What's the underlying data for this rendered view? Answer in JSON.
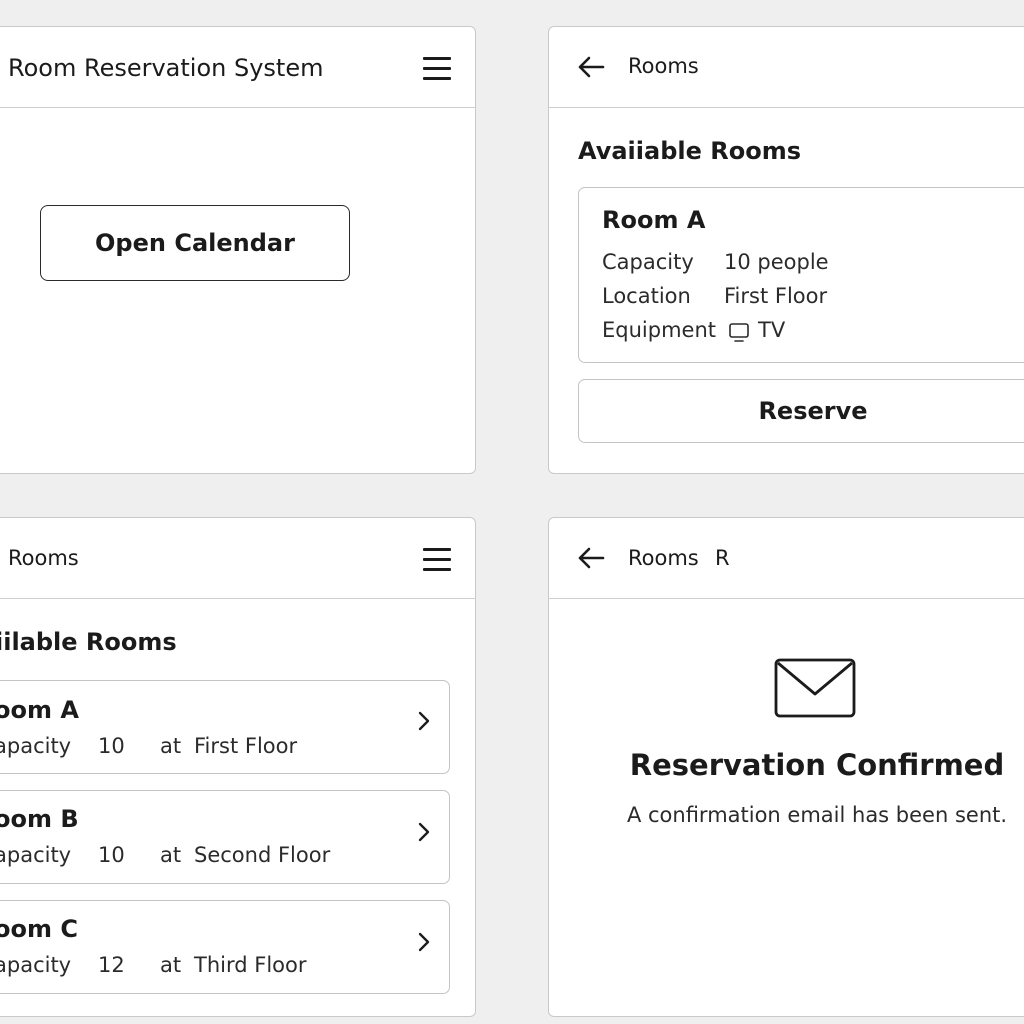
{
  "home": {
    "title": "Room Reservation System",
    "menu_icon": "hamburger-menu-icon",
    "open_calendar_label": "Open Calendar"
  },
  "detail": {
    "back_icon": "arrow-left-icon",
    "header_label": "Rooms",
    "section_title": "Avaiiable Rooms",
    "room": {
      "name": "Room A",
      "capacity_label": "Capacity",
      "capacity_value": "10 people",
      "location_label": "Location",
      "location_value": "First Floor",
      "equipment_label": "Equipment",
      "equipment_icon": "tv-icon",
      "equipment_value": "TV"
    },
    "reserve_label": "Reserve"
  },
  "list": {
    "header_label": "Rooms",
    "menu_icon": "hamburger-menu-icon",
    "section_title": "iilable Rooms",
    "rooms": [
      {
        "name": "oom A",
        "capacity_label": "apacity",
        "capacity": "10",
        "at": "at",
        "location": "First Floor"
      },
      {
        "name": "oom B",
        "capacity_label": "apacity",
        "capacity": "10",
        "at": "at",
        "location": "Second Floor"
      },
      {
        "name": "oom C",
        "capacity_label": "apacity",
        "capacity": "12",
        "at": "at",
        "location": "Third Floor"
      }
    ],
    "chevron_icon": "chevron-right-icon"
  },
  "confirm": {
    "back_icon": "arrow-left-icon",
    "header_label": "Rooms",
    "header_extra": "R",
    "mail_icon": "envelope-icon",
    "title": "Reservation Confirmed",
    "message": "A confirmation email has been sent."
  },
  "colors": {
    "background": "#efefef",
    "panel": "#ffffff",
    "border": "#c9c9c9",
    "text": "#1b1b1b"
  }
}
